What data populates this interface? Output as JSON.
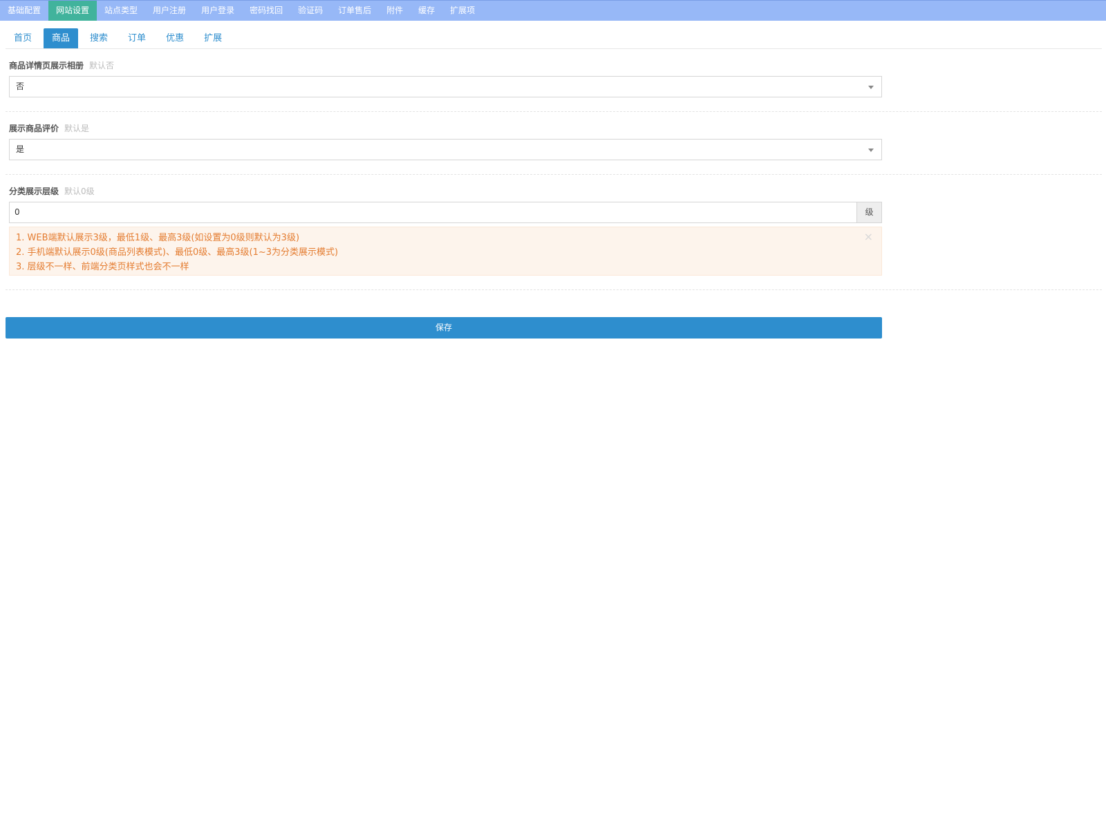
{
  "top_nav": {
    "items": [
      {
        "label": "基础配置"
      },
      {
        "label": "网站设置"
      },
      {
        "label": "站点类型"
      },
      {
        "label": "用户注册"
      },
      {
        "label": "用户登录"
      },
      {
        "label": "密码找回"
      },
      {
        "label": "验证码"
      },
      {
        "label": "订单售后"
      },
      {
        "label": "附件"
      },
      {
        "label": "缓存"
      },
      {
        "label": "扩展项"
      }
    ],
    "active_index": 1
  },
  "sub_tabs": {
    "items": [
      {
        "label": "首页"
      },
      {
        "label": "商品"
      },
      {
        "label": "搜索"
      },
      {
        "label": "订单"
      },
      {
        "label": "优惠"
      },
      {
        "label": "扩展"
      }
    ],
    "active_index": 1
  },
  "form": {
    "album": {
      "label": "商品详情页展示相册",
      "hint": "默认否",
      "value": "否"
    },
    "comments": {
      "label": "展示商品评价",
      "hint": "默认是",
      "value": "是"
    },
    "category_level": {
      "label": "分类展示层级",
      "hint": "默认0级",
      "value": "0",
      "unit": "级",
      "tips": [
        "1. WEB端默认展示3级，最低1级、最高3级(如设置为0级则默认为3级)",
        "2. 手机端默认展示0级(商品列表模式)、最低0级、最高3级(1~3为分类展示模式)",
        "3. 层级不一样、前端分类页样式也会不一样"
      ],
      "close_glyph": "×"
    }
  },
  "save_label": "保存",
  "colors": {
    "top_nav_bg": "#97b8f7",
    "top_nav_active": "#41b39c",
    "primary": "#2e8ece",
    "warning_text": "#e47c30",
    "warning_bg": "#fdf4ec"
  },
  "icons": {
    "select_caret": "chevron-down-icon",
    "alert_close": "close-icon"
  }
}
